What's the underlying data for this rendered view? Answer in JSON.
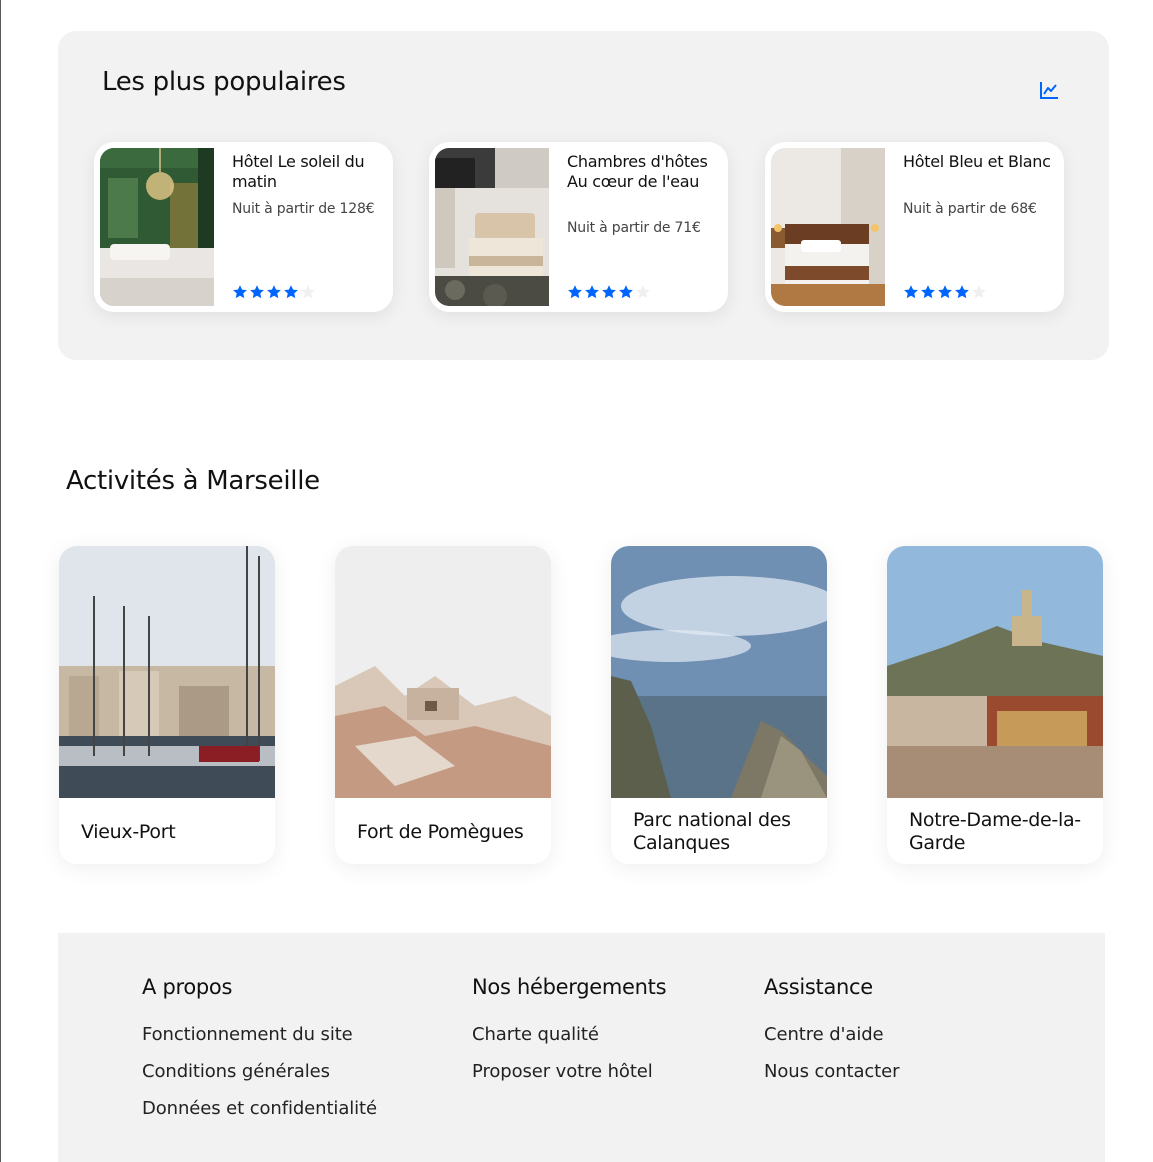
{
  "popular": {
    "title": "Les plus populaires",
    "icon": "trend-chart-icon",
    "accent_color": "#0065fc",
    "hotels": [
      {
        "name": "Hôtel Le soleil du matin",
        "price": "Nuit à partir de 128€",
        "rating": 4,
        "max_rating": 5
      },
      {
        "name": "Chambres d'hôtes Au cœur de l'eau",
        "price": "Nuit à partir de 71€",
        "rating": 4,
        "max_rating": 5
      },
      {
        "name": "Hôtel Bleu et Blanc",
        "price": "Nuit à partir de 68€",
        "rating": 4,
        "max_rating": 5
      }
    ]
  },
  "activities": {
    "title": "Activités à Marseille",
    "items": [
      {
        "label": "Vieux-Port"
      },
      {
        "label": "Fort de Pomègues"
      },
      {
        "label": "Parc national des Calanques"
      },
      {
        "label": "Notre-Dame-de-la-Garde"
      }
    ]
  },
  "footer": {
    "columns": [
      {
        "heading": "A propos",
        "links": [
          "Fonctionnement du site",
          "Conditions générales",
          "Données et confidentialité"
        ]
      },
      {
        "heading": "Nos hébergements",
        "links": [
          "Charte qualité",
          "Proposer votre hôtel"
        ]
      },
      {
        "heading": "Assistance",
        "links": [
          "Centre d'aide",
          "Nous contacter"
        ]
      }
    ]
  }
}
